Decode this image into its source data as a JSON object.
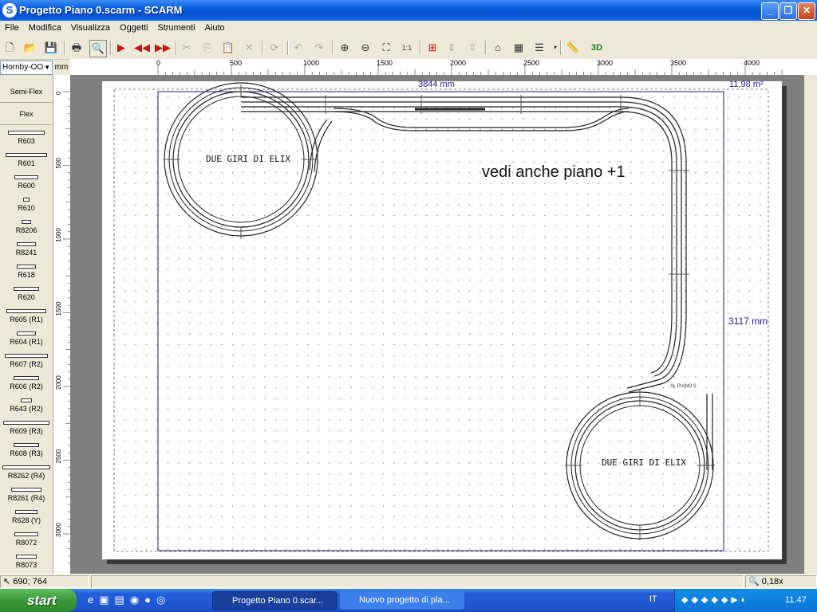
{
  "window": {
    "title": "Progetto Piano 0.scarm - SCARM",
    "app_icon": "S"
  },
  "menu": [
    "File",
    "Modifica",
    "Visualizza",
    "Oggetti",
    "Strumenti",
    "Aiuto"
  ],
  "library": {
    "selected": "Hornby-OO",
    "unit": "mm"
  },
  "palette": {
    "buttons": [
      "Semi-Flex",
      "Flex"
    ],
    "items": [
      "R603",
      "R601",
      "R600",
      "R610",
      "R8206",
      "R8241",
      "R618",
      "R620",
      "R605 (R1)",
      "R604 (R1)",
      "R607 (R2)",
      "R606 (R2)",
      "R643 (R2)",
      "R609 (R3)",
      "R608 (R3)",
      "R8262 (R4)",
      "R8261 (R4)",
      "R628 (Y)",
      "R8072",
      "R8073"
    ]
  },
  "hruler": {
    "labels": [
      "0",
      "500",
      "1000",
      "1500",
      "2000",
      "2500",
      "3000",
      "3500",
      "4000"
    ]
  },
  "vruler": {
    "labels": [
      "0",
      "500",
      "1000",
      "1500",
      "2000",
      "2500",
      "3000"
    ]
  },
  "canvas": {
    "width_label": "3844 mm",
    "area_label": "11,98 m²",
    "height_label": "3117 mm",
    "loop_label_1": "DUE GIRI DI ELIX",
    "loop_label_2": "DUE GIRI DI ELIX",
    "note": "vedi anche piano +1",
    "small_label": "AL PIANO 0"
  },
  "status": {
    "coords": "690; 764",
    "zoom": "0,18x"
  },
  "taskbar": {
    "start": "start",
    "tasks": [
      "Progetto Piano 0.scar...",
      "Nuovo progetto di pla..."
    ],
    "lang": "IT",
    "clock": "11.47"
  },
  "colors": {
    "track": "#222222",
    "label_blue": "#1a1a9a",
    "board_border": "#1a1a7a"
  }
}
